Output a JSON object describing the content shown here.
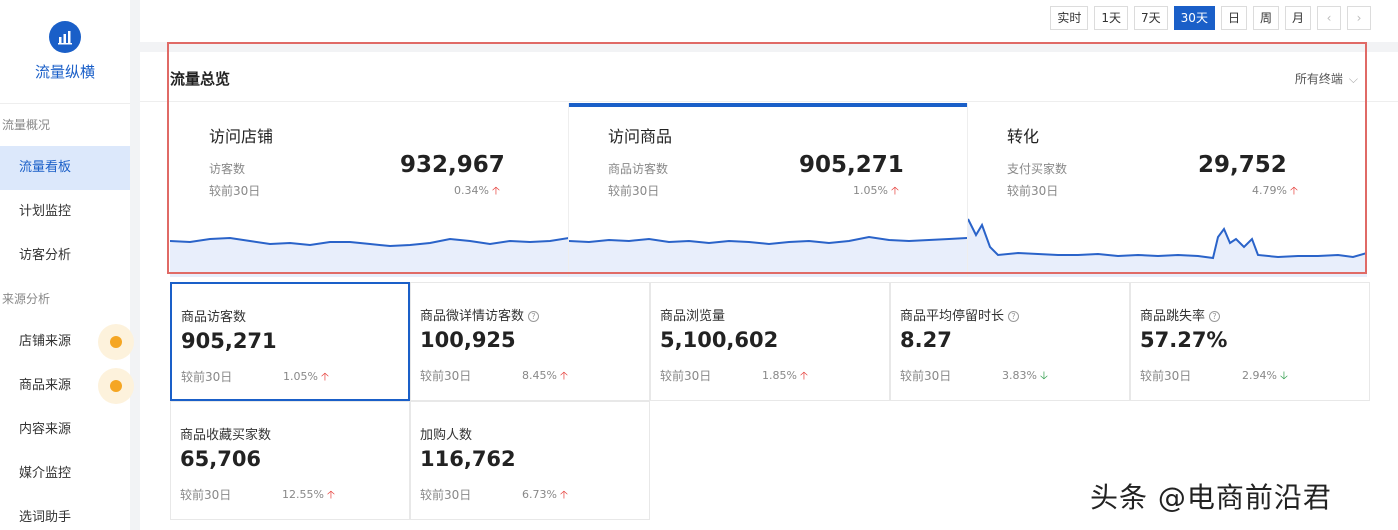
{
  "sidebar": {
    "brand": "流量纵横",
    "groups": [
      {
        "label": "流量概况",
        "items": [
          {
            "label": "流量看板"
          },
          {
            "label": "计划监控"
          },
          {
            "label": "访客分析"
          }
        ]
      },
      {
        "label": "来源分析",
        "items": [
          {
            "label": "店铺来源"
          },
          {
            "label": "商品来源"
          },
          {
            "label": "内容来源"
          },
          {
            "label": "媒介监控"
          },
          {
            "label": "选词助手"
          }
        ]
      }
    ]
  },
  "time_range": {
    "buttons": [
      "实时",
      "1天",
      "7天",
      "30天",
      "日",
      "周",
      "月"
    ],
    "selected": "30天",
    "prev": "‹",
    "next": "›"
  },
  "overview": {
    "title": "流量总览",
    "terminal": "所有终端",
    "cards": [
      {
        "title": "访问店铺",
        "label": "访客数",
        "value": "932,967",
        "cmp_label": "较前30日",
        "cmp_value": "0.34%",
        "trend": "up"
      },
      {
        "title": "访问商品",
        "label": "商品访客数",
        "value": "905,271",
        "cmp_label": "较前30日",
        "cmp_value": "1.05%",
        "trend": "up"
      },
      {
        "title": "转化",
        "label": "支付买家数",
        "value": "29,752",
        "cmp_label": "较前30日",
        "cmp_value": "4.79%",
        "trend": "up"
      }
    ]
  },
  "metrics": [
    {
      "name": "商品访客数",
      "value": "905,271",
      "cmp_label": "较前30日",
      "cmp_value": "1.05%",
      "trend": "up",
      "help": false
    },
    {
      "name": "商品微详情访客数",
      "value": "100,925",
      "cmp_label": "较前30日",
      "cmp_value": "8.45%",
      "trend": "up",
      "help": true
    },
    {
      "name": "商品浏览量",
      "value": "5,100,602",
      "cmp_label": "较前30日",
      "cmp_value": "1.85%",
      "trend": "up",
      "help": false
    },
    {
      "name": "商品平均停留时长",
      "value": "8.27",
      "cmp_label": "较前30日",
      "cmp_value": "3.83%",
      "trend": "down",
      "help": true
    },
    {
      "name": "商品跳失率",
      "value": "57.27%",
      "cmp_label": "较前30日",
      "cmp_value": "2.94%",
      "trend": "down",
      "help": true
    },
    {
      "name": "商品收藏买家数",
      "value": "65,706",
      "cmp_label": "较前30日",
      "cmp_value": "12.55%",
      "trend": "up",
      "help": false
    },
    {
      "name": "加购人数",
      "value": "116,762",
      "cmp_label": "较前30日",
      "cmp_value": "6.73%",
      "trend": "up",
      "help": false
    }
  ],
  "watermark": "头条 @电商前沿君",
  "colors": {
    "accent": "#1a5fc8",
    "up": "#e53935",
    "down": "#2e9d4a",
    "highlight_frame": "#e06a66"
  }
}
